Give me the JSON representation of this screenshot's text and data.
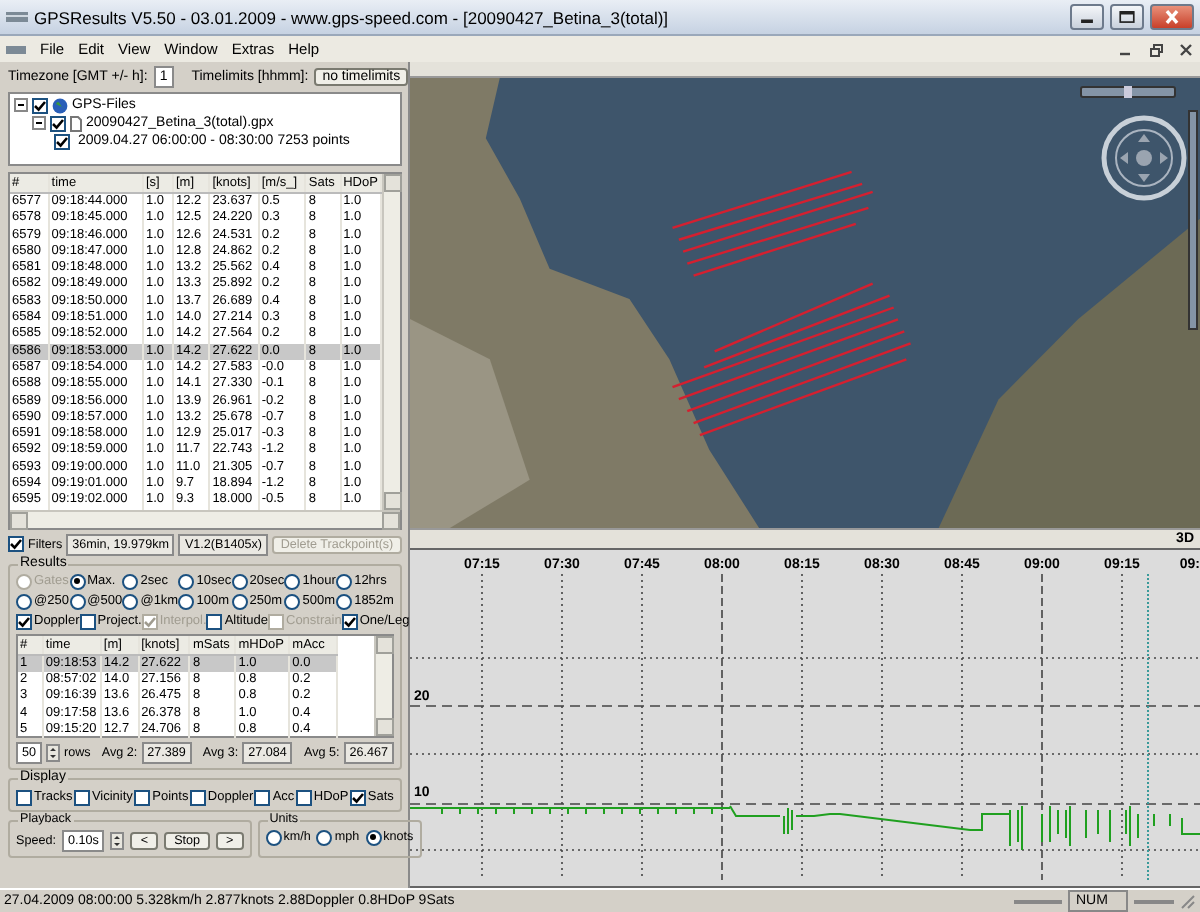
{
  "window": {
    "title": "GPSResults V5.50 - 03.01.2009 - www.gps-speed.com - [20090427_Betina_3(total)]"
  },
  "menu": [
    "File",
    "Edit",
    "View",
    "Window",
    "Extras",
    "Help"
  ],
  "timezone": {
    "label": "Timezone [GMT +/- h]:",
    "value": "1"
  },
  "timelimits": {
    "label": "Timelimits [hhmm]:",
    "button": "no timelimits"
  },
  "file_tree": [
    {
      "label": "GPS-Files",
      "checked": true,
      "expanded": true,
      "children": [
        {
          "label": "20090427_Betina_3(total).gpx",
          "checked": true,
          "expanded": true,
          "children": [
            {
              "label": "2009.04.27 06:00:00 - 08:30:00",
              "points": "7253 points",
              "checked": true
            }
          ]
        }
      ]
    }
  ],
  "trackpoints": {
    "columns": [
      "#",
      "time",
      "[s]",
      "[m]",
      "[knots]",
      "[m/s_]",
      "Sats",
      "HDoP"
    ],
    "rows": [
      {
        "cells": [
          "6577",
          "09:18:44.000",
          "1.0",
          "12.2",
          "23.637",
          "0.5",
          "8",
          "1.0"
        ],
        "selected": false
      },
      {
        "cells": [
          "6578",
          "09:18:45.000",
          "1.0",
          "12.5",
          "24.220",
          "0.3",
          "8",
          "1.0"
        ],
        "selected": false
      },
      {
        "cells": [
          "6579",
          "09:18:46.000",
          "1.0",
          "12.6",
          "24.531",
          "0.2",
          "8",
          "1.0"
        ],
        "selected": false
      },
      {
        "cells": [
          "6580",
          "09:18:47.000",
          "1.0",
          "12.8",
          "24.862",
          "0.2",
          "8",
          "1.0"
        ],
        "selected": false
      },
      {
        "cells": [
          "6581",
          "09:18:48.000",
          "1.0",
          "13.2",
          "25.562",
          "0.4",
          "8",
          "1.0"
        ],
        "selected": false
      },
      {
        "cells": [
          "6582",
          "09:18:49.000",
          "1.0",
          "13.3",
          "25.892",
          "0.2",
          "8",
          "1.0"
        ],
        "selected": false
      },
      {
        "cells": [
          "6583",
          "09:18:50.000",
          "1.0",
          "13.7",
          "26.689",
          "0.4",
          "8",
          "1.0"
        ],
        "selected": false
      },
      {
        "cells": [
          "6584",
          "09:18:51.000",
          "1.0",
          "14.0",
          "27.214",
          "0.3",
          "8",
          "1.0"
        ],
        "selected": false
      },
      {
        "cells": [
          "6585",
          "09:18:52.000",
          "1.0",
          "14.2",
          "27.564",
          "0.2",
          "8",
          "1.0"
        ],
        "selected": false
      },
      {
        "cells": [
          "6586",
          "09:18:53.000",
          "1.0",
          "14.2",
          "27.622",
          "0.0",
          "8",
          "1.0"
        ],
        "selected": true
      },
      {
        "cells": [
          "6587",
          "09:18:54.000",
          "1.0",
          "14.2",
          "27.583",
          "-0.0",
          "8",
          "1.0"
        ],
        "selected": false
      },
      {
        "cells": [
          "6588",
          "09:18:55.000",
          "1.0",
          "14.1",
          "27.330",
          "-0.1",
          "8",
          "1.0"
        ],
        "selected": false
      },
      {
        "cells": [
          "6589",
          "09:18:56.000",
          "1.0",
          "13.9",
          "26.961",
          "-0.2",
          "8",
          "1.0"
        ],
        "selected": false
      },
      {
        "cells": [
          "6590",
          "09:18:57.000",
          "1.0",
          "13.2",
          "25.678",
          "-0.7",
          "8",
          "1.0"
        ],
        "selected": false
      },
      {
        "cells": [
          "6591",
          "09:18:58.000",
          "1.0",
          "12.9",
          "25.017",
          "-0.3",
          "8",
          "1.0"
        ],
        "selected": false
      },
      {
        "cells": [
          "6592",
          "09:18:59.000",
          "1.0",
          "11.7",
          "22.743",
          "-1.2",
          "8",
          "1.0"
        ],
        "selected": false
      },
      {
        "cells": [
          "6593",
          "09:19:00.000",
          "1.0",
          "11.0",
          "21.305",
          "-0.7",
          "8",
          "1.0"
        ],
        "selected": false
      },
      {
        "cells": [
          "6594",
          "09:19:01.000",
          "1.0",
          "9.7",
          "18.894",
          "-1.2",
          "8",
          "1.0"
        ],
        "selected": false
      },
      {
        "cells": [
          "6595",
          "09:19:02.000",
          "1.0",
          "9.3",
          "18.000",
          "-0.5",
          "8",
          "1.0"
        ],
        "selected": false
      }
    ]
  },
  "filters": {
    "label": "Filters",
    "checked": true,
    "summary": "36min, 19.979km",
    "version": "V1.2(B1405x)",
    "delete_button": {
      "label": "Delete Trackpoint(s)",
      "disabled": true
    }
  },
  "results": {
    "title": "Results",
    "modes": [
      {
        "label": "Gates",
        "selected": false,
        "disabled": true
      },
      {
        "label": "Max.",
        "selected": true,
        "disabled": false
      },
      {
        "label": "2sec",
        "selected": false,
        "disabled": false
      },
      {
        "label": "10sec",
        "selected": false,
        "disabled": false
      },
      {
        "label": "20sec",
        "selected": false,
        "disabled": false
      },
      {
        "label": "1hour",
        "selected": false,
        "disabled": false
      },
      {
        "label": "12hrs",
        "selected": false,
        "disabled": false
      },
      {
        "label": "@250",
        "selected": false,
        "disabled": false
      },
      {
        "label": "@500",
        "selected": false,
        "disabled": false
      },
      {
        "label": "@1km",
        "selected": false,
        "disabled": false
      },
      {
        "label": "100m",
        "selected": false,
        "disabled": false
      },
      {
        "label": "250m",
        "selected": false,
        "disabled": false
      },
      {
        "label": "500m",
        "selected": false,
        "disabled": false
      },
      {
        "label": "1852m",
        "selected": false,
        "disabled": false
      }
    ],
    "options": [
      {
        "label": "Doppler",
        "checked": true,
        "disabled": false
      },
      {
        "label": "Project.",
        "checked": false,
        "disabled": false
      },
      {
        "label": "Interpol.",
        "checked": true,
        "disabled": true
      },
      {
        "label": "Altitude",
        "checked": false,
        "disabled": false
      },
      {
        "label": "Constrain",
        "checked": false,
        "disabled": true
      },
      {
        "label": "One/Leg",
        "checked": true,
        "disabled": false
      }
    ],
    "columns": [
      "#",
      "time",
      "[m]",
      "[knots]",
      "mSats",
      "mHDoP",
      "mAcc"
    ],
    "rows": [
      {
        "cells": [
          "1",
          "09:18:53",
          "14.2",
          "27.622",
          "8",
          "1.0",
          "0.0"
        ],
        "selected": true
      },
      {
        "cells": [
          "2",
          "08:57:02",
          "14.0",
          "27.156",
          "8",
          "0.8",
          "0.2"
        ],
        "selected": false
      },
      {
        "cells": [
          "3",
          "09:16:39",
          "13.6",
          "26.475",
          "8",
          "0.8",
          "0.2"
        ],
        "selected": false
      },
      {
        "cells": [
          "4",
          "09:17:58",
          "13.6",
          "26.378",
          "8",
          "1.0",
          "0.4"
        ],
        "selected": false
      },
      {
        "cells": [
          "5",
          "09:15:20",
          "12.7",
          "24.706",
          "8",
          "0.8",
          "0.4"
        ],
        "selected": false
      }
    ],
    "row_count": "50",
    "row_count_label": "rows",
    "averages": [
      {
        "label": "Avg 2:",
        "value": "27.389"
      },
      {
        "label": "Avg 3:",
        "value": "27.084"
      },
      {
        "label": "Avg 5:",
        "value": "26.467"
      }
    ]
  },
  "display": {
    "title": "Display",
    "options": [
      {
        "label": "Tracks",
        "checked": false
      },
      {
        "label": "Vicinity",
        "checked": false
      },
      {
        "label": "Points",
        "checked": false
      },
      {
        "label": "Doppler",
        "checked": false
      },
      {
        "label": "Acc",
        "checked": false
      },
      {
        "label": "HDoP",
        "checked": false
      },
      {
        "label": "Sats",
        "checked": true
      }
    ]
  },
  "playback": {
    "title": "Playback",
    "speed_label": "Speed:",
    "speed": "0.10s",
    "buttons": [
      "<",
      "Stop",
      ">"
    ]
  },
  "units": {
    "title": "Units",
    "options": [
      {
        "label": "km/h",
        "selected": false
      },
      {
        "label": "mph",
        "selected": false
      },
      {
        "label": "knots",
        "selected": true
      }
    ]
  },
  "map": {
    "mode_label": "3D"
  },
  "speed_graph": {
    "x_labels": [
      "07:15",
      "07:30",
      "07:45",
      "08:00",
      "08:15",
      "08:30",
      "08:45",
      "09:00",
      "09:15",
      "09:"
    ],
    "y_labels": [
      "20",
      "10"
    ]
  },
  "status_bar": {
    "text": "27.04.2009 08:00:00 5.328km/h 2.877knots 2.88Doppler 0.8HDoP 9Sats",
    "indicator": "NUM"
  }
}
